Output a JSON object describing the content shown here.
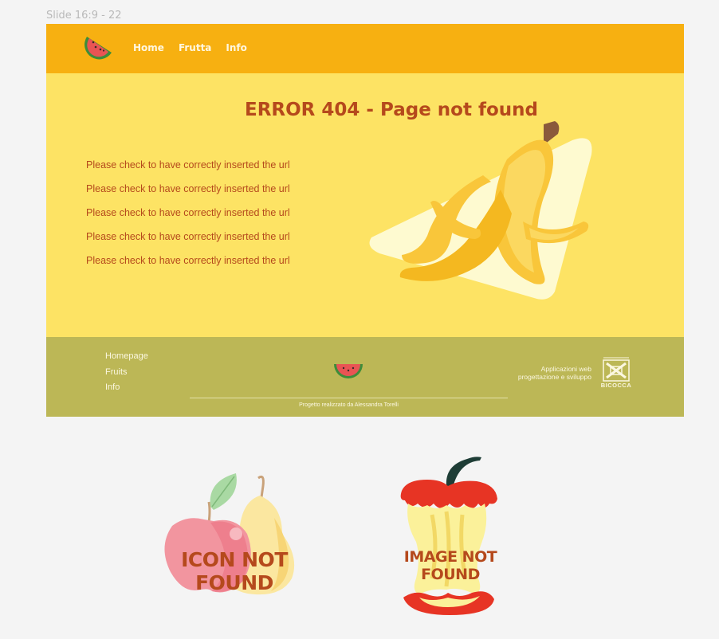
{
  "canvas": {
    "frame_label": "Slide 16:9 - 22"
  },
  "navbar": {
    "logo_icon": "watermelon-slice-icon",
    "links": [
      {
        "label": "Home"
      },
      {
        "label": "Frutta"
      },
      {
        "label": "Info"
      }
    ]
  },
  "error": {
    "title": "ERROR 404 - Page not found",
    "messages": [
      "Please check to have correctly inserted the url",
      "Please check to have correctly inserted the url",
      "Please check to have correctly inserted the url",
      "Please check to have correctly inserted the url",
      "Please check to have correctly inserted the url"
    ],
    "illustration": "banana-peel-on-board-icon"
  },
  "footer": {
    "links": [
      {
        "label": "Homepage"
      },
      {
        "label": "Fruits"
      },
      {
        "label": "Info"
      }
    ],
    "logo_icon": "watermelon-slice-icon",
    "credit": "Progetto realizzato da Alessandra Torelli",
    "course_line1": "Applicazioni web",
    "course_line2": "progettazione e sviluppo",
    "university_logo": "university-seal-icon",
    "university_name": "BICOCCA"
  },
  "placeholders": {
    "icon_not_found": "ICON NOT FOUND",
    "icon_art": "apple-and-pear-icon",
    "image_not_found": "IMAGE NOT FOUND",
    "image_art": "apple-core-icon"
  },
  "colors": {
    "background": "#f4f4f4",
    "navbar": "#f7b011",
    "content": "#fde364",
    "footer": "#bcb756",
    "accent_text": "#b5491c"
  }
}
